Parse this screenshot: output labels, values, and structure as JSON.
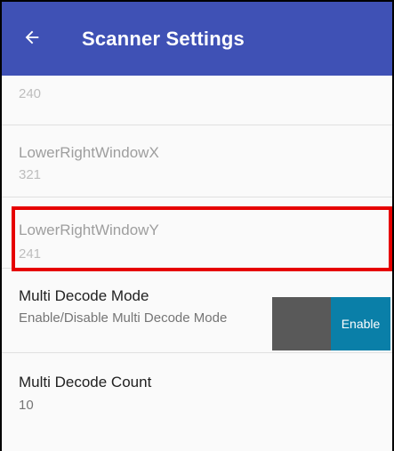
{
  "app_bar": {
    "title": "Scanner Settings",
    "back_icon": "arrow-left-icon",
    "color": "#3f51b5"
  },
  "settings": {
    "partial": {
      "value": "240"
    },
    "lower_right_x": {
      "title": "LowerRightWindowX",
      "value": "321"
    },
    "lower_right_y": {
      "title": "LowerRightWindowY",
      "value": "241"
    },
    "multi_decode_mode": {
      "title": "Multi Decode Mode",
      "description": "Enable/Disable Multi Decode Mode",
      "toggle_label": "Enable"
    },
    "multi_decode_count": {
      "title": "Multi Decode Count",
      "value": "10"
    }
  },
  "colors": {
    "highlight": "#e60000",
    "toggle_on": "#0a7fa8",
    "toggle_off": "#595959"
  }
}
